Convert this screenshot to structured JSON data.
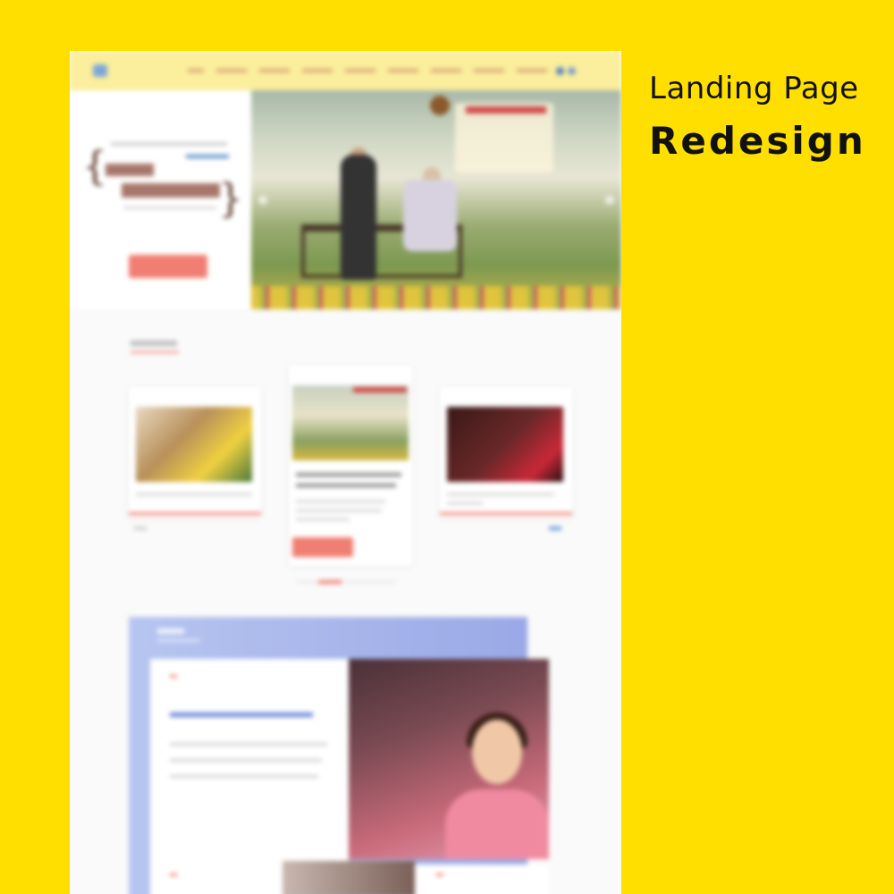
{
  "heading": {
    "line1": "Landing Page",
    "line2": "Redesign"
  },
  "mockup": {
    "style": "blurred",
    "accent_color": "#f07e72",
    "nav_color": "#fbee9c",
    "feature_gradient": [
      "#b7c5f0",
      "#9aa8e6"
    ]
  }
}
